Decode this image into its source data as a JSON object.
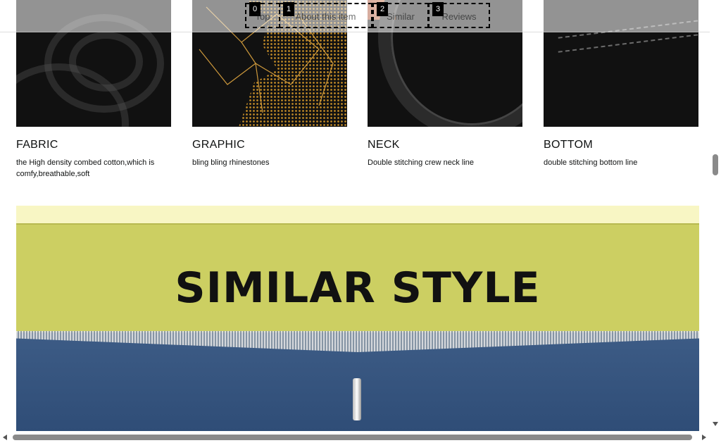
{
  "features": [
    {
      "title": "FABRIC",
      "description": "the High density combed cotton,which is comfy,breathable,soft",
      "image_icon": "fabric-closeup-image"
    },
    {
      "title": "GRAPHIC",
      "description": "bling bling rhinestones",
      "image_icon": "rhinestone-graphic-image"
    },
    {
      "title": "NECK",
      "description": "Double stitching crew neck line",
      "image_icon": "crew-neck-image"
    },
    {
      "title": "BOTTOM",
      "description": "double stitching bottom line",
      "image_icon": "bottom-hem-image"
    }
  ],
  "banner": {
    "heading": "SIMILAR STYLE",
    "image_icon": "zipper-denim-image"
  },
  "nav": {
    "tabs": [
      {
        "badge": "0",
        "label": "Top"
      },
      {
        "badge": "1",
        "label": "About this item"
      },
      {
        "badge": "2",
        "label": "Similar"
      },
      {
        "badge": "3",
        "label": "Reviews"
      }
    ]
  },
  "colors": {
    "banner_yellow": "#cccf62",
    "denim_blue": "#3d5c86",
    "badge_black": "#000000"
  }
}
